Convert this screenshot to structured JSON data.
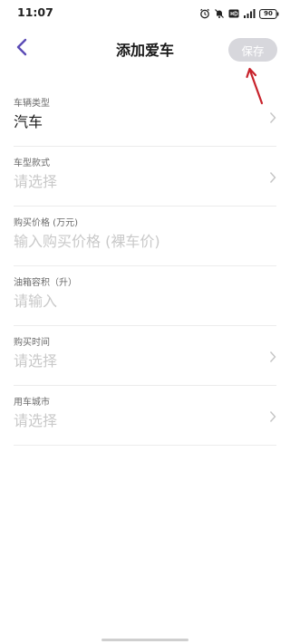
{
  "status_bar": {
    "time": "11:07",
    "battery": "90"
  },
  "nav": {
    "title": "添加爱车",
    "save_label": "保存"
  },
  "form": {
    "fields": [
      {
        "label": "车辆类型",
        "value": "汽车",
        "is_placeholder": false,
        "has_chevron": true
      },
      {
        "label": "车型款式",
        "value": "请选择",
        "is_placeholder": true,
        "has_chevron": true
      },
      {
        "label": "购买价格 (万元)",
        "value": "输入购买价格 (裸车价)",
        "is_placeholder": true,
        "has_chevron": false
      },
      {
        "label": "油箱容积（升）",
        "value": "请输入",
        "is_placeholder": true,
        "has_chevron": false
      },
      {
        "label": "购买时间",
        "value": "请选择",
        "is_placeholder": true,
        "has_chevron": true
      },
      {
        "label": "用车城市",
        "value": "请选择",
        "is_placeholder": true,
        "has_chevron": true
      }
    ]
  },
  "colors": {
    "accent": "#5b4bb5",
    "save_disabled_bg": "#d7d7dc",
    "annotation": "#c8232c",
    "placeholder": "#c9c9c9"
  },
  "icons": {
    "back": "chevron-left-icon",
    "row": "chevron-right-icon",
    "annotation": "red-arrow-icon"
  }
}
